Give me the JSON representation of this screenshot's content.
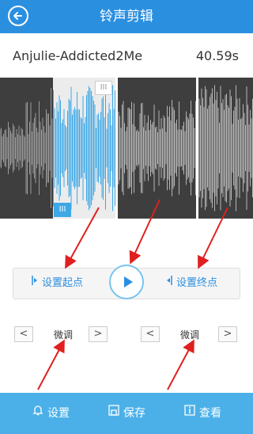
{
  "header": {
    "title": "铃声剪辑",
    "back_icon": "circle-arrow-left-icon"
  },
  "song": {
    "name": "Anjulie-Addicted2Me",
    "duration": "40.59s"
  },
  "controls": {
    "set_start_label": "设置起点",
    "set_end_label": "设置终点",
    "play_icon": "play-icon"
  },
  "fine_tune": {
    "start_label": "微调",
    "end_label": "微调",
    "left": "<",
    "right": ">"
  },
  "handles": {
    "top": "III",
    "bottom": "III"
  },
  "bottom_bar": {
    "items": [
      {
        "label": "设置",
        "icon": "bell-icon"
      },
      {
        "label": "保存",
        "icon": "save-icon"
      },
      {
        "label": "查看",
        "icon": "info-icon"
      }
    ]
  },
  "colors": {
    "header": "#2b8fe0",
    "bottom_bar": "#4bb0e8",
    "accent": "#2b8fe0",
    "selected_wave": "#3ea8e6"
  }
}
